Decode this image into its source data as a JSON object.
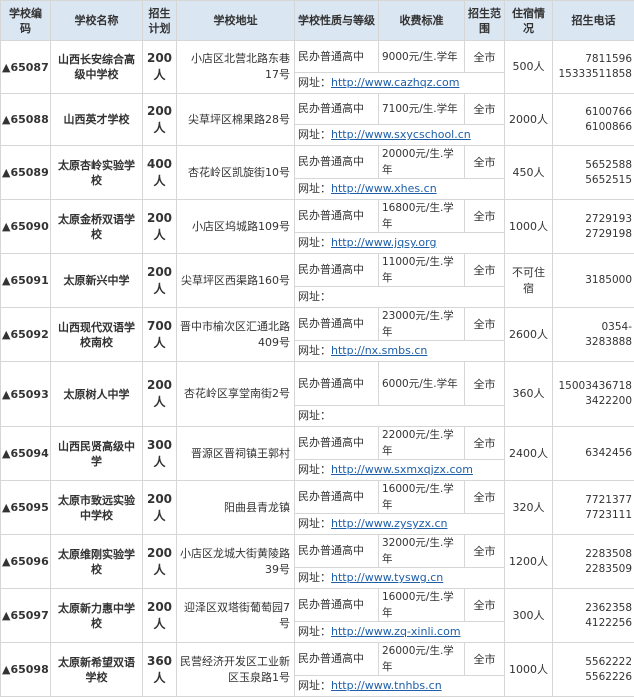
{
  "header": {
    "code": "学校编码",
    "name": "学校名称",
    "plan": "招生计划",
    "address": "学校地址",
    "nature": "学校性质与等级",
    "fee": "收费标准",
    "range": "招生范围",
    "board": "住宿情况",
    "phone": "招生电话"
  },
  "web_label": "网址：",
  "rows": [
    {
      "code": "▲65087",
      "name": "山西长安综合高级中学校",
      "plan": "200人",
      "address": "小店区北营北路东巷17号",
      "nature": "民办普通高中",
      "fee": "9000元/生.学年",
      "range": "全市",
      "board": "500人",
      "phone": "7811596 15333511858",
      "url": "http://www.cazhqz.com"
    },
    {
      "code": "▲65088",
      "name": "山西英才学校",
      "plan": "200人",
      "address": "尖草坪区棉果路28号",
      "nature": "民办普通高中",
      "fee": "7100元/生.学年",
      "range": "全市",
      "board": "2000人",
      "phone": "6100766 6100866",
      "url": "http://www.sxycschool.cn"
    },
    {
      "code": "▲65089",
      "name": "太原杏岭实验学校",
      "plan": "400人",
      "address": "杏花岭区凯旋街10号",
      "nature": "民办普通高中",
      "fee": "20000元/生.学年",
      "range": "全市",
      "board": "450人",
      "phone": "5652588 5652515",
      "url": "http://www.xhes.cn"
    },
    {
      "code": "▲65090",
      "name": "太原金桥双语学校",
      "plan": "200人",
      "address": "小店区坞城路109号",
      "nature": "民办普通高中",
      "fee": "16800元/生.学年",
      "range": "全市",
      "board": "1000人",
      "phone": "2729193 2729198",
      "url": "http://www.jqsy.org"
    },
    {
      "code": "▲65091",
      "name": "太原新兴中学",
      "plan": "200人",
      "address": "尖草坪区西渠路160号",
      "nature": "民办普通高中",
      "fee": "11000元/生.学年",
      "range": "全市",
      "board": "不可住宿",
      "phone": "3185000",
      "url": ""
    },
    {
      "code": "▲65092",
      "name": "山西现代双语学校南校",
      "plan": "700人",
      "address": "晋中市榆次区汇通北路409号",
      "nature": "民办普通高中",
      "fee": "23000元/生.学年",
      "range": "全市",
      "board": "2600人",
      "phone": "0354-3283888",
      "url": "http://nx.smbs.cn"
    },
    {
      "code": "▲65093",
      "name": "太原树人中学",
      "plan": "200人",
      "address": "杏花岭区享堂南街2号",
      "nature": "民办普通高中",
      "fee": "6000元/生.学年",
      "range": "全市",
      "board": "360人",
      "phone": "15003436718 3422200",
      "url": ""
    },
    {
      "code": "▲65094",
      "name": "山西民贤高级中学",
      "plan": "300人",
      "address": "晋源区晋祠镇王郭村",
      "nature": "民办普通高中",
      "fee": "22000元/生.学年",
      "range": "全市",
      "board": "2400人",
      "phone": "6342456",
      "url": "http://www.sxmxqjzx.com"
    },
    {
      "code": "▲65095",
      "name": "太原市致远实验中学校",
      "plan": "200人",
      "address": "阳曲县青龙镇",
      "nature": "民办普通高中",
      "fee": "16000元/生.学年",
      "range": "全市",
      "board": "320人",
      "phone": "7721377 7723111",
      "url": "http://www.zysyzx.cn"
    },
    {
      "code": "▲65096",
      "name": "太原维刚实验学校",
      "plan": "200人",
      "address": "小店区龙城大街黄陵路39号",
      "nature": "民办普通高中",
      "fee": "32000元/生.学年",
      "range": "全市",
      "board": "1200人",
      "phone": "2283508 2283509",
      "url": "http://www.tyswg.cn"
    },
    {
      "code": "▲65097",
      "name": "太原新力惠中学校",
      "plan": "200人",
      "address": "迎泽区双塔街葡萄园7号",
      "nature": "民办普通高中",
      "fee": "16000元/生.学年",
      "range": "全市",
      "board": "300人",
      "phone": "2362358 4122256",
      "url": "http://www.zq-xinli.com"
    },
    {
      "code": "▲65098",
      "name": "太原新希望双语学校",
      "plan": "360人",
      "address": "民营经济开发区工业新区玉泉路1号",
      "nature": "民办普通高中",
      "fee": "26000元/生.学年",
      "range": "全市",
      "board": "1000人",
      "phone": "5562222 5562226",
      "url": "http://www.tnhbs.cn"
    }
  ]
}
